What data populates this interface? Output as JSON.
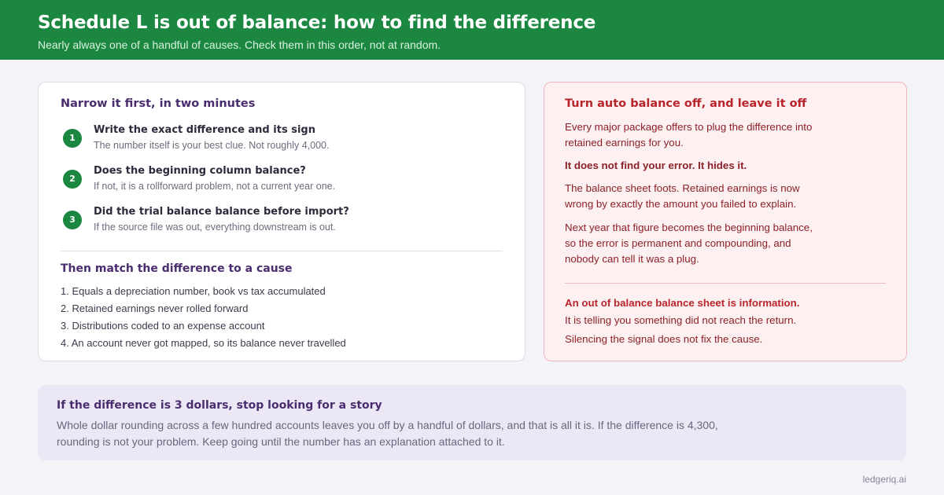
{
  "header": {
    "title": "Schedule L is out of balance: how to find the difference",
    "subtitle": "Nearly always one of a handful of causes. Check them in this order, not at random."
  },
  "left_card": {
    "heading": "Narrow it first, in two minutes",
    "steps": [
      {
        "num": "1",
        "title": "Write the exact difference and its sign",
        "desc": "The number itself is your best clue. Not roughly 4,000."
      },
      {
        "num": "2",
        "title": "Does the beginning column balance?",
        "desc": "If not, it is a rollforward problem, not a current year one."
      },
      {
        "num": "3",
        "title": "Did the trial balance balance before import?",
        "desc": "If the source file was out, everything downstream is out."
      }
    ],
    "causes_heading": "Then match the difference to a cause",
    "causes": [
      "1. Equals a depreciation number, book vs tax accumulated",
      "2. Retained earnings never rolled forward",
      "3. Distributions coded to an expense account",
      "4. An account never got mapped, so its balance never travelled"
    ]
  },
  "right_card": {
    "heading": "Turn auto balance off, and leave it off",
    "p1": "Every major package offers to plug the difference into retained earnings for you.",
    "strong1": "It does not find your error. It hides it.",
    "p2": "The balance sheet foots. Retained earnings is now wrong by exactly the amount you failed to explain.",
    "p3": "Next year that figure becomes the beginning balance, so the error is permanent and compounding, and nobody can tell it was a plug.",
    "strong2": "An out of balance balance sheet is information.",
    "tail1": "It is telling you something did not reach the return.",
    "tail2": "Silencing the signal does not fix the cause."
  },
  "banner": {
    "heading": "If the difference is 3 dollars, stop looking for a story",
    "text": "Whole dollar rounding across a few hundred accounts leaves you off by a handful of dollars, and that is all it is. If the difference is 4,300, rounding is not your problem. Keep going until the number has an explanation attached to it."
  },
  "footer": {
    "brand": "ledgeriq.ai"
  }
}
